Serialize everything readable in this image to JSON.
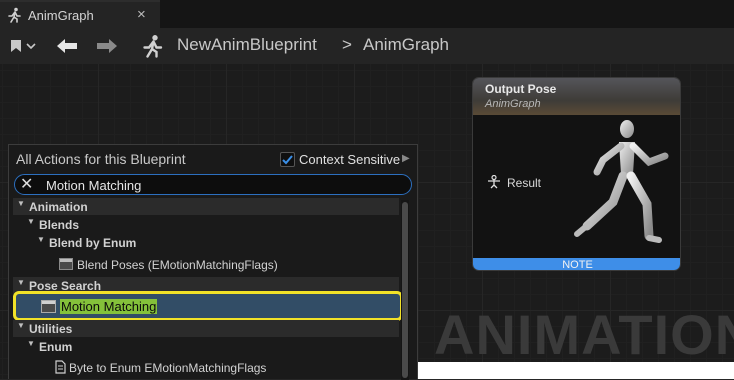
{
  "tab": {
    "label": "AnimGraph",
    "close": "×",
    "icon": "running-figure-icon"
  },
  "toolbar": {
    "breadcrumb": [
      "NewAnimBlueprint",
      "AnimGraph"
    ],
    "separator": ">",
    "icons": [
      "bookmark-icon",
      "chevron-down-icon",
      "back-arrow-icon",
      "forward-arrow-icon",
      "running-figure-icon"
    ]
  },
  "node": {
    "title": "Output Pose",
    "subtitle": "AnimGraph",
    "pin_label": "Result",
    "note_label": "NOTE",
    "note_color": "#3e8ee8"
  },
  "watermark": "ANIMATION",
  "actions": {
    "title": "All Actions for this Blueprint",
    "context_sensitive_label": "Context Sensitive",
    "context_sensitive_checked": true,
    "search_value": "Motion Matching",
    "tree": [
      {
        "text": "Animation",
        "type": "category"
      },
      {
        "text": "Blends",
        "type": "subcategory"
      },
      {
        "text": "Blend by Enum",
        "type": "subcategory"
      },
      {
        "text": "Blend Poses (EMotionMatchingFlags)",
        "type": "item"
      },
      {
        "text": "Pose Search",
        "type": "category"
      },
      {
        "text": "Motion Matching",
        "type": "item",
        "selected": true
      },
      {
        "text": "Utilities",
        "type": "category"
      },
      {
        "text": "Enum",
        "type": "subcategory"
      },
      {
        "text": "Byte to Enum EMotionMatchingFlags",
        "type": "function"
      }
    ],
    "selection_color": "#f2e228",
    "highlight_color": "#84c13a"
  }
}
